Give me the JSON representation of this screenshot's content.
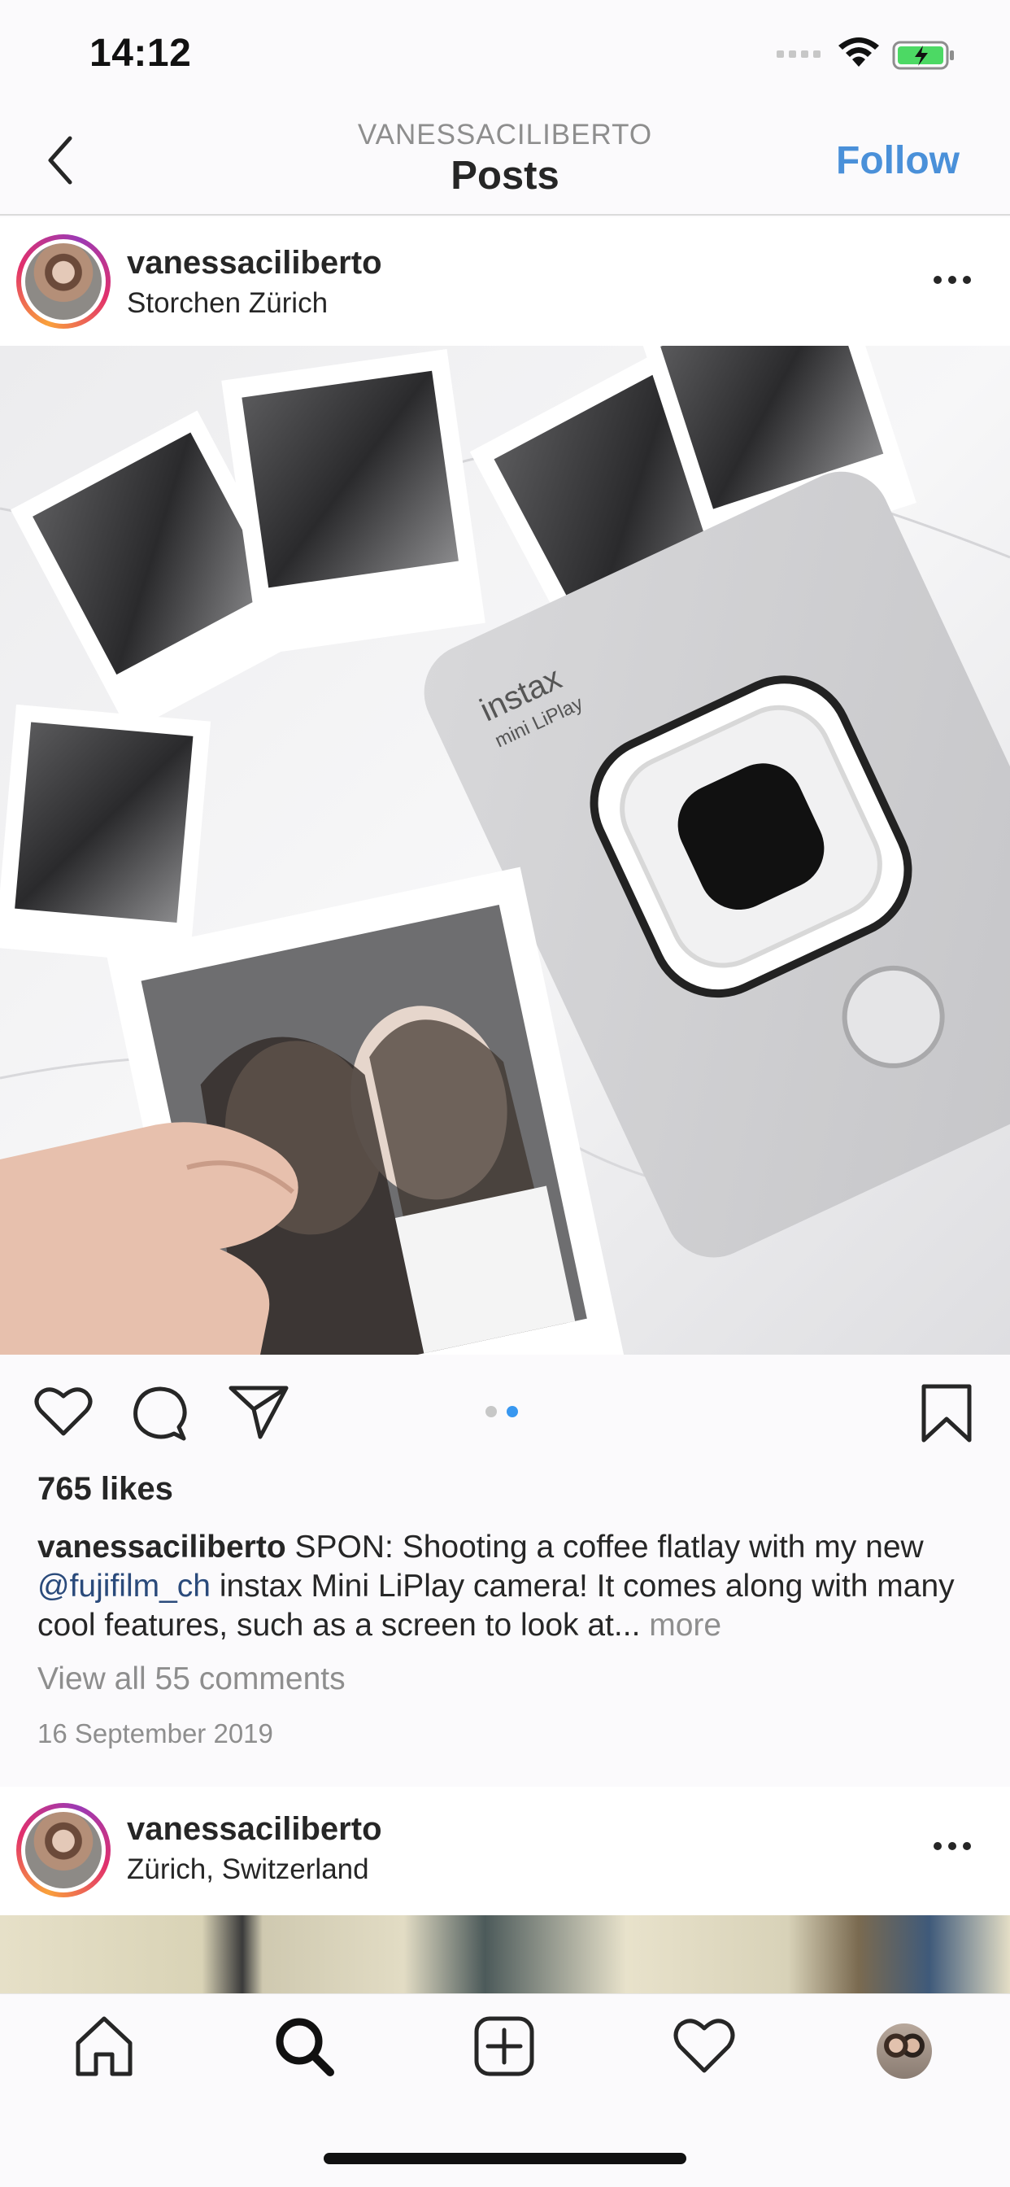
{
  "status_bar": {
    "time": "14:12"
  },
  "header": {
    "account": "VANESSACILIBERTO",
    "title": "Posts",
    "follow_label": "Follow"
  },
  "posts": [
    {
      "username": "vanessaciliberto",
      "location": "Storchen Zürich",
      "image_alt": "",
      "likes": "765 likes",
      "caption": {
        "username": "vanessaciliberto",
        "text_1": " SPON: Shooting a coffee flatlay with my new ",
        "mention": "@fujifilm_ch",
        "text_2": " instax Mini LiPlay camera! It comes along with many cool features, such as a screen to look at...",
        "more": " more"
      },
      "view_comments": "View all 55 comments",
      "date": "16 September 2019",
      "carousel": {
        "count": 2,
        "active": 2
      }
    },
    {
      "username": "vanessaciliberto",
      "location": "Zürich, Switzerland"
    }
  ],
  "icons": {
    "back": "chevron-left-icon",
    "more": "more-horizontal-icon",
    "like": "heart-icon",
    "comment": "comment-bubble-icon",
    "share": "paper-plane-icon",
    "save": "bookmark-icon",
    "tabs": [
      "home-icon",
      "search-icon",
      "new-post-icon",
      "activity-heart-icon",
      "profile-avatar"
    ]
  },
  "colors": {
    "follow": "#4a90d9",
    "mention": "#2a4a7b",
    "muted": "#8e8e8e",
    "carousel_active": "#3897f0",
    "carousel_inactive": "#c7c7c7"
  }
}
